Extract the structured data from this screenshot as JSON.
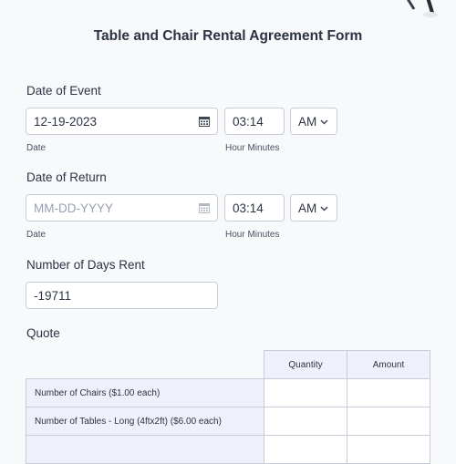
{
  "form": {
    "title": "Table and Chair Rental Agreement Form"
  },
  "event_date": {
    "label": "Date of Event",
    "date_value": "12-19-2023",
    "time_value": "03:14",
    "ampm_value": "AM",
    "date_sublabel": "Date",
    "time_sublabel": "Hour Minutes"
  },
  "return_date": {
    "label": "Date of Return",
    "date_placeholder": "MM-DD-YYYY",
    "time_value": "03:14",
    "ampm_value": "AM",
    "date_sublabel": "Date",
    "time_sublabel": "Hour Minutes"
  },
  "days_rent": {
    "label": "Number of Days Rent",
    "value": "-19711"
  },
  "quote": {
    "label": "Quote",
    "columns": [
      "Quantity",
      "Amount"
    ],
    "rows": [
      "Number of Chairs ($1.00 each)",
      "Number of Tables - Long (4ftx2ft) ($6.00 each)"
    ]
  },
  "icons": {
    "date": "calendar-icon",
    "select": "chevron-down-icon"
  },
  "colors": {
    "text": "#2c3345",
    "border": "#c8ccd8",
    "table_header": "#eef1f9"
  }
}
